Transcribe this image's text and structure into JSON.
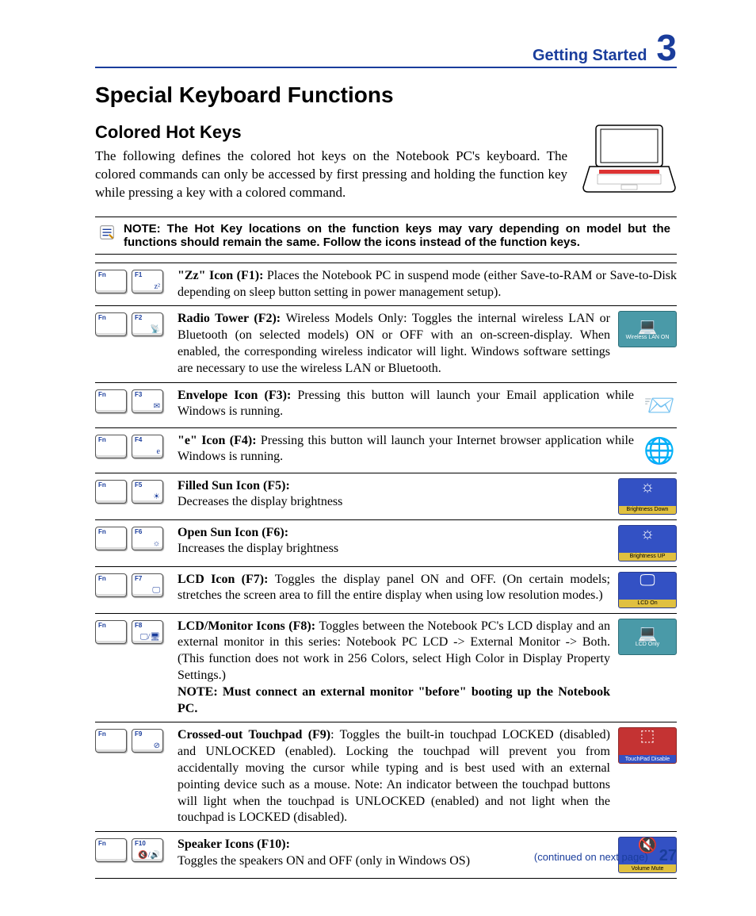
{
  "header": {
    "title": "Getting Started",
    "chapter": "3"
  },
  "h1": "Special Keyboard Functions",
  "h2": "Colored Hot Keys",
  "intro": "The following defines the colored hot keys on the Notebook PC's keyboard. The colored commands can only be accessed by first pressing and holding the function key while pressing a key with a colored command.",
  "note": "NOTE: The Hot Key locations on the function keys may vary depending on model but the functions should remain the same. Follow the icons instead of the function keys.",
  "fn_label": "Fn",
  "rows": [
    {
      "fkey": "F1",
      "kicon": "z²",
      "title": "\"Zz\" Icon (F1): ",
      "body": "Places the Notebook PC in suspend mode (either Save-to-RAM or Save-to-Disk depending on sleep button setting in power management setup).",
      "osd": null
    },
    {
      "fkey": "F2",
      "kicon": "📡",
      "title": "Radio Tower (F2): ",
      "body": "Wireless Models Only: Toggles the internal wireless LAN or Bluetooth (on selected models) ON or OFF with an on-screen-display. When enabled, the corresponding wireless indicator will light. Windows software settings are necessary to use the wireless LAN or Bluetooth.",
      "osd": {
        "type": "teal",
        "glyph": "💻",
        "label": "Wireless LAN ON"
      }
    },
    {
      "fkey": "F3",
      "kicon": "✉",
      "title": "Envelope Icon (F3): ",
      "body": "Pressing this button will launch your Email application while Windows is running.",
      "osd": {
        "type": "app",
        "glyph": "📨"
      }
    },
    {
      "fkey": "F4",
      "kicon": "e",
      "title": "\"e\" Icon (F4): ",
      "body": "Pressing this button will launch your Internet browser application while Windows is running.",
      "osd": {
        "type": "app",
        "glyph": "🌐"
      }
    },
    {
      "fkey": "F5",
      "kicon": "☀",
      "title": "Filled Sun Icon (F5):",
      "body": "Decreases the display brightness",
      "osd": {
        "type": "blue",
        "glyph": "☼",
        "label": "Brightness Down"
      }
    },
    {
      "fkey": "F6",
      "kicon": "☼",
      "title": "Open Sun Icon (F6):",
      "body": "Increases the display brightness",
      "osd": {
        "type": "blue",
        "glyph": "☼",
        "label": "Brightness UP"
      }
    },
    {
      "fkey": "F7",
      "kicon": "🖵",
      "title": "LCD Icon (F7): ",
      "body": "Toggles the display panel ON and OFF. (On certain models; stretches the screen area to fill the entire display when using low resolution modes.)",
      "osd": {
        "type": "blue",
        "glyph": "🖵",
        "label": "LCD On"
      }
    },
    {
      "fkey": "F8",
      "kicon": "🖵/🖥",
      "title": "LCD/Monitor Icons (F8): ",
      "body": "Toggles between the Notebook PC's LCD display and an external monitor in this series: Notebook PC LCD -> External Monitor -> Both. (This function does not work in 256 Colors, select High Color in Display Property Settings.)",
      "extra_note": "NOTE: Must connect an external monitor \"before\" booting up the Notebook PC.",
      "osd": {
        "type": "teal",
        "glyph": "💻",
        "label": "LCD Only"
      }
    },
    {
      "fkey": "F9",
      "kicon": "⊘",
      "title": "Crossed-out Touchpad (F9)",
      "body": ": Toggles the built-in touchpad LOCKED (disabled) and UNLOCKED (enabled). Locking the touchpad will prevent you from accidentally moving the cursor while typing and is best used with an external pointing device such as a mouse. Note: An indicator between the touchpad buttons will light when the touchpad is UNLOCKED (enabled) and not light when the touchpad is LOCKED (disabled).",
      "osd": {
        "type": "red",
        "glyph": "⬚",
        "label": "TouchPad Disable"
      }
    },
    {
      "fkey": "F10",
      "kicon": "🔇/🔊",
      "title": "Speaker Icons (F10):",
      "body": "Toggles the speakers ON and OFF (only in Windows OS)",
      "osd": {
        "type": "blue",
        "glyph": "🔇",
        "label": "Volume Mute"
      }
    }
  ],
  "footer": {
    "cont": "(continued on next page)",
    "page": "27"
  }
}
